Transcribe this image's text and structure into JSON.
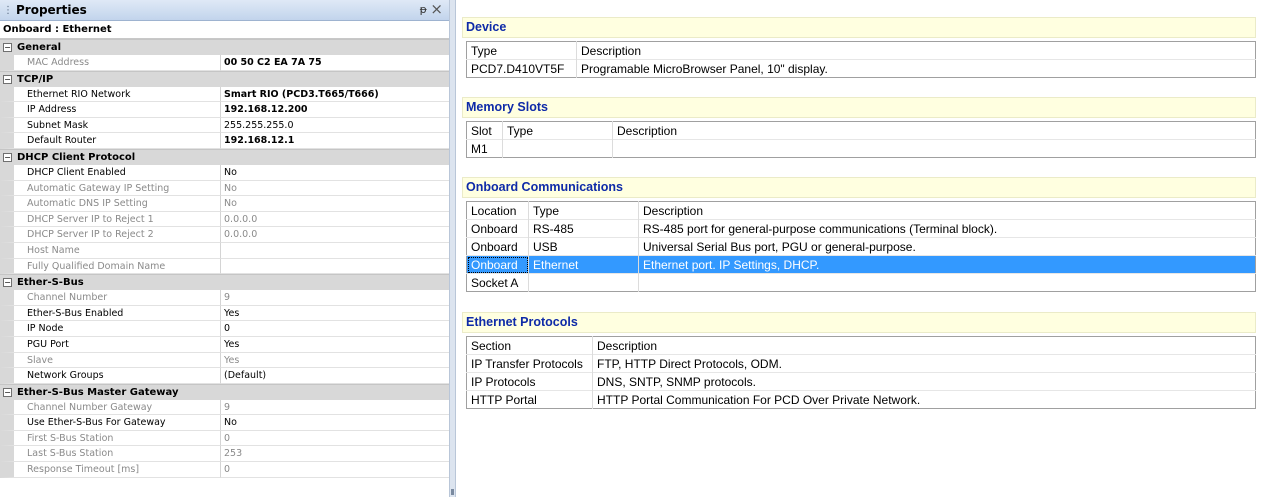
{
  "properties": {
    "title": "Properties",
    "object": "Onboard : Ethernet",
    "categories": [
      {
        "label": "General",
        "rows": [
          {
            "label": "MAC Address",
            "value": "00 50 C2 EA 7A 75",
            "ro": true,
            "bold": true
          }
        ]
      },
      {
        "label": "TCP/IP",
        "rows": [
          {
            "label": "Ethernet RIO Network",
            "value": "Smart RIO (PCD3.T665/T666)",
            "ro": false,
            "bold": true
          },
          {
            "label": "IP Address",
            "value": "192.168.12.200",
            "ro": false,
            "bold": true
          },
          {
            "label": "Subnet Mask",
            "value": "255.255.255.0",
            "ro": false,
            "bold": false
          },
          {
            "label": "Default Router",
            "value": "192.168.12.1",
            "ro": false,
            "bold": true
          }
        ]
      },
      {
        "label": "DHCP Client Protocol",
        "rows": [
          {
            "label": "DHCP Client Enabled",
            "value": "No",
            "ro": false,
            "bold": false
          },
          {
            "label": "Automatic Gateway IP Setting",
            "value": "No",
            "ro": true,
            "bold": false
          },
          {
            "label": "Automatic DNS IP Setting",
            "value": "No",
            "ro": true,
            "bold": false
          },
          {
            "label": "DHCP Server IP to Reject 1",
            "value": "0.0.0.0",
            "ro": true,
            "bold": false
          },
          {
            "label": "DHCP Server IP to Reject 2",
            "value": "0.0.0.0",
            "ro": true,
            "bold": false
          },
          {
            "label": "Host Name",
            "value": "",
            "ro": true,
            "bold": false
          },
          {
            "label": "Fully Qualified Domain Name",
            "value": "",
            "ro": true,
            "bold": false
          }
        ]
      },
      {
        "label": "Ether-S-Bus",
        "rows": [
          {
            "label": "Channel Number",
            "value": "9",
            "ro": true,
            "bold": false
          },
          {
            "label": "Ether-S-Bus Enabled",
            "value": "Yes",
            "ro": false,
            "bold": false
          },
          {
            "label": "IP Node",
            "value": "0",
            "ro": false,
            "bold": false
          },
          {
            "label": "PGU Port",
            "value": "Yes",
            "ro": false,
            "bold": false
          },
          {
            "label": "Slave",
            "value": "Yes",
            "ro": true,
            "bold": false
          },
          {
            "label": "Network Groups",
            "value": "(Default)",
            "ro": false,
            "bold": false
          }
        ]
      },
      {
        "label": "Ether-S-Bus Master Gateway",
        "rows": [
          {
            "label": "Channel Number Gateway",
            "value": "9",
            "ro": true,
            "bold": false
          },
          {
            "label": "Use Ether-S-Bus For Gateway",
            "value": "No",
            "ro": false,
            "bold": false
          },
          {
            "label": "First S-Bus Station",
            "value": "0",
            "ro": true,
            "bold": false
          },
          {
            "label": "Last S-Bus Station",
            "value": "253",
            "ro": true,
            "bold": false
          },
          {
            "label": "Response Timeout [ms]",
            "value": "0",
            "ro": true,
            "bold": false
          }
        ]
      }
    ]
  },
  "sections": [
    {
      "key": "device",
      "title": "Device",
      "columns": [
        "Type",
        "Description"
      ],
      "rows": [
        [
          "PCD7.D410VT5F",
          "Programable MicroBrowser Panel, 10\" display."
        ]
      ]
    },
    {
      "key": "memory",
      "title": "Memory Slots",
      "columns": [
        "Slot",
        "Type",
        "Description"
      ],
      "rows": [
        [
          "M1",
          "",
          ""
        ]
      ]
    },
    {
      "key": "comms",
      "title": "Onboard Communications",
      "columns": [
        "Location",
        "Type",
        "Description"
      ],
      "selected_row": 2,
      "rows": [
        [
          "Onboard",
          "RS-485",
          "RS-485 port for general-purpose communications (Terminal block)."
        ],
        [
          "Onboard",
          "USB",
          "Universal Serial Bus port, PGU or general-purpose."
        ],
        [
          "Onboard",
          "Ethernet",
          "Ethernet port. IP Settings, DHCP."
        ],
        [
          "Socket A",
          "",
          ""
        ]
      ]
    },
    {
      "key": "protocols",
      "title": "Ethernet Protocols",
      "columns": [
        "Section",
        "Description"
      ],
      "rows": [
        [
          "IP Transfer Protocols",
          "FTP, HTTP Direct Protocols, ODM."
        ],
        [
          "IP Protocols",
          "DNS, SNTP, SNMP protocols."
        ],
        [
          "HTTP Portal",
          "HTTP Portal Communication For PCD Over Private Network."
        ]
      ]
    }
  ],
  "colors": {
    "section_header_bg": "#ffffe0",
    "section_header_text": "#0e2aa8",
    "selection": "#3399ff"
  }
}
